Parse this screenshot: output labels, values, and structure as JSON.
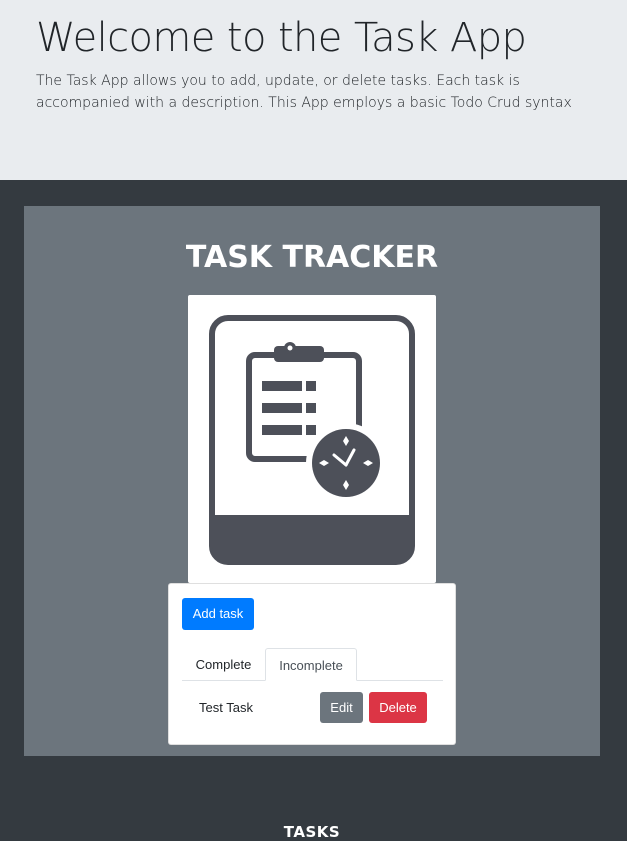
{
  "header": {
    "title": "Welcome to the Task App",
    "lead": "The Task App allows you to add, update, or delete tasks. Each task is accompanied with a description. This App employs a basic Todo Crud syntax"
  },
  "tracker": {
    "title": "TASK TRACKER",
    "logo": {
      "icon": "clipboard-clock-icon",
      "caption": "TASKS"
    }
  },
  "task_card": {
    "add_label": "Add task",
    "tabs": [
      {
        "label": "Complete",
        "active": false
      },
      {
        "label": "Incomplete",
        "active": true
      }
    ],
    "tasks": [
      {
        "name": "Test Task",
        "edit_label": "Edit",
        "delete_label": "Delete"
      }
    ]
  },
  "colors": {
    "jumbotron_bg": "#e9ecef",
    "page_bg": "#343a40",
    "panel_bg": "#6c757d",
    "primary": "#007bff",
    "secondary": "#6c757d",
    "danger": "#dc3545",
    "logo_dark": "#4d5059"
  }
}
